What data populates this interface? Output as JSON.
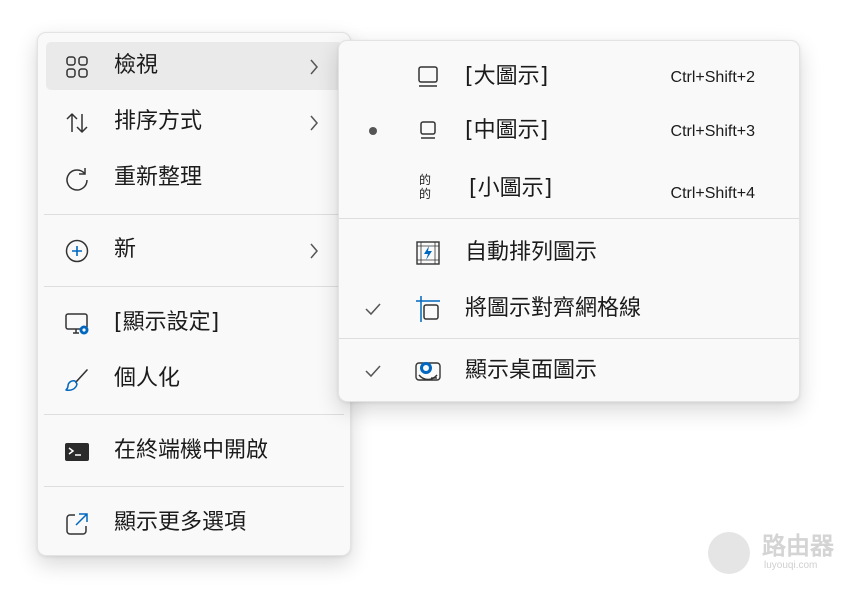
{
  "main_menu": {
    "items": [
      {
        "label": "檢視",
        "icon": "grid-view-icon",
        "has_submenu": true
      },
      {
        "label": "排序方式",
        "icon": "sort-arrows-icon",
        "has_submenu": true
      },
      {
        "label": "重新整理",
        "icon": "refresh-icon",
        "has_submenu": false
      },
      {
        "label": "新",
        "icon": "add-circle-icon",
        "has_submenu": true
      },
      {
        "label": "[顯示設定]",
        "icon": "display-settings-icon",
        "has_submenu": false
      },
      {
        "label": "個人化",
        "icon": "brush-icon",
        "has_submenu": false
      },
      {
        "label": "在終端機中開啟",
        "icon": "terminal-icon",
        "has_submenu": false
      },
      {
        "label": "顯示更多選項",
        "icon": "share-icon",
        "has_submenu": false
      }
    ]
  },
  "view_submenu": {
    "items": [
      {
        "label": "[大圖示]",
        "shortcut": "Ctrl+Shift+2",
        "icon": "large-icons-icon",
        "mark": ""
      },
      {
        "label": "[中圖示]",
        "shortcut": "Ctrl+Shift+3",
        "icon": "medium-icons-icon",
        "mark": "bullet"
      },
      {
        "label": "[小圖示]",
        "shortcut": "Ctrl+Shift+4",
        "icon": "small-icons-icon",
        "icon_text": "的的",
        "mark": ""
      },
      {
        "label": "自動排列圖示",
        "icon": "auto-arrange-icon",
        "mark": ""
      },
      {
        "label": "將圖示對齊網格線",
        "icon": "align-grid-icon",
        "mark": "check"
      },
      {
        "label": "顯示桌面圖示",
        "icon": "show-desktop-icons-icon",
        "mark": "check"
      }
    ]
  },
  "watermark": {
    "title": "路由器",
    "url": "luyouqi.com"
  },
  "colors": {
    "accent": "#0067c0",
    "menu_bg": "#f9f9f9",
    "hover_bg": "#eaeaea"
  }
}
